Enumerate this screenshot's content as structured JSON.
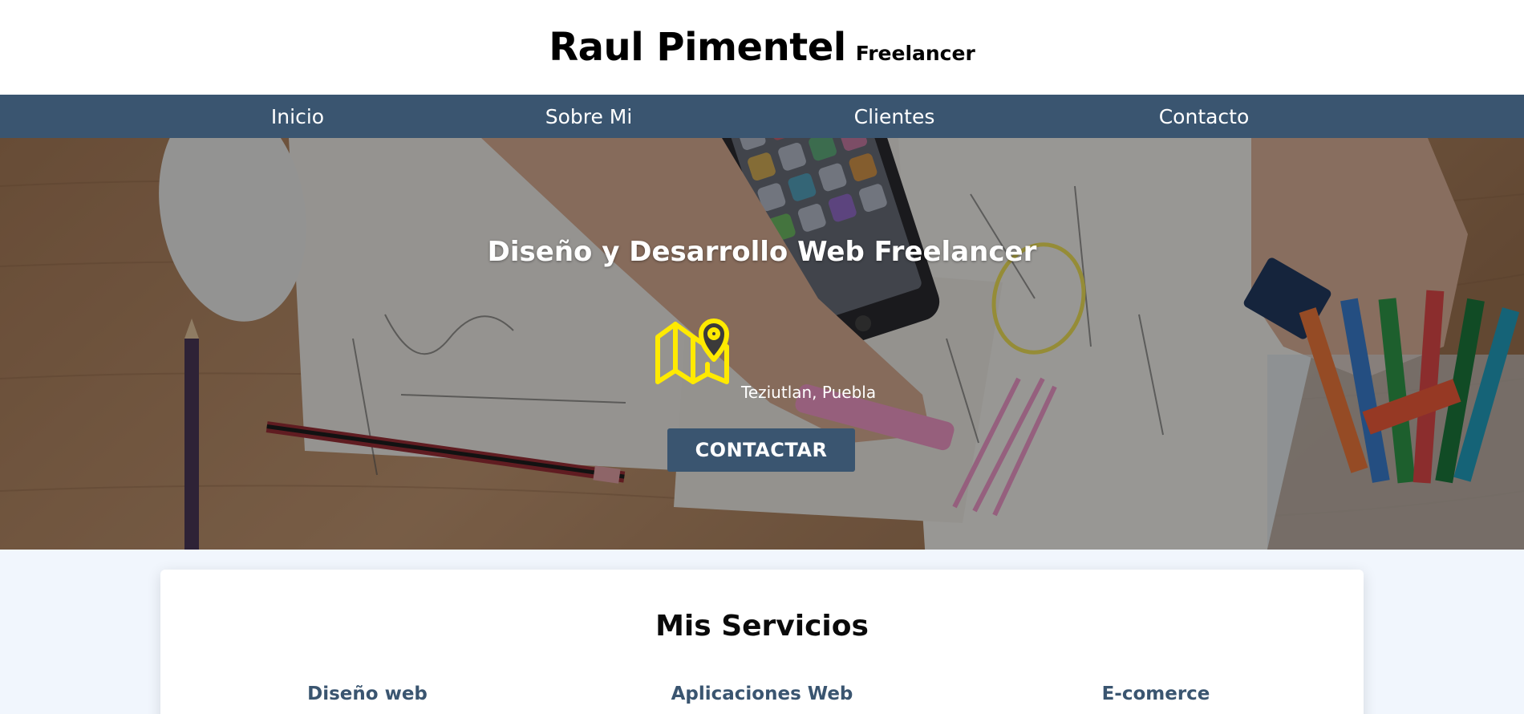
{
  "header": {
    "brand_name": "Raul Pimentel",
    "brand_tagline": "Freelancer"
  },
  "nav": {
    "items": [
      {
        "label": "Inicio"
      },
      {
        "label": "Sobre Mi"
      },
      {
        "label": "Clientes"
      },
      {
        "label": "Contacto"
      }
    ]
  },
  "hero": {
    "title": "Diseño y Desarrollo Web Freelancer",
    "location_icon": "map-location-icon",
    "location": "Teziutlan, Puebla",
    "cta_label": "CONTACTAR",
    "background": "desk-workspace-photo"
  },
  "services": {
    "title": "Mis Servicios",
    "items": [
      {
        "label": "Diseño web"
      },
      {
        "label": "Aplicaciones Web"
      },
      {
        "label": "E-comerce"
      }
    ]
  },
  "colors": {
    "primary": "#3a5570",
    "accent_icon": "#ffea00",
    "page_background": "#f1f6fd"
  }
}
